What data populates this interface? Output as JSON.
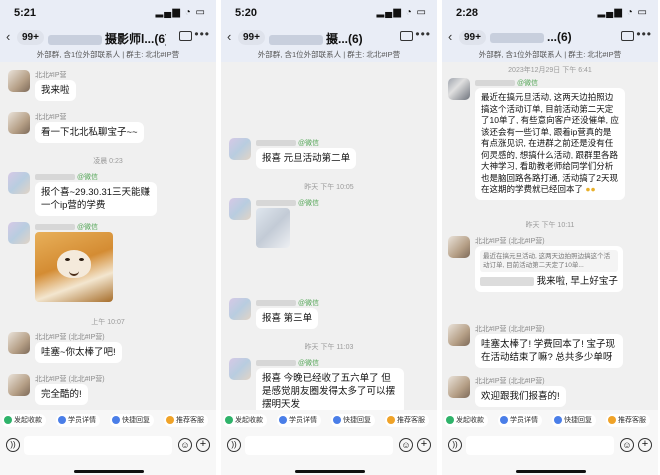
{
  "screens": [
    {
      "time": "5:21",
      "badge": "99+",
      "title": "摄影师l...(6)",
      "subinfo": "外部群, 含1位外部联系人 | 群主: 北北#IP营",
      "quick": [
        "发起收款",
        "学员详情",
        "快捷回复",
        "推荐客服"
      ],
      "messages": [
        {
          "name": "北北#IP营",
          "text": "我来啦"
        },
        {
          "name": "北北#IP营",
          "text": "看一下北北私聊宝子~~"
        },
        {
          "stamp": "凌晨 0:23"
        },
        {
          "name": "@微信",
          "text": "报个喜~29.30.31三天能赚一个ip营的学费"
        },
        {
          "name": "@微信",
          "image": "dog-emoji"
        },
        {
          "stamp": "上午 10:07"
        },
        {
          "name": "北北#IP营 (北北#IP营)",
          "text": "哇塞~你太棒了吧!"
        },
        {
          "name": "北北#IP营 (北北#IP营)",
          "text": "完全酷的!"
        }
      ]
    },
    {
      "time": "5:20",
      "badge": "99+",
      "title": "摄...(6)",
      "subinfo": "外部群, 含1位外部联系人 | 群主: 北北#IP营",
      "quick": [
        "发起收款",
        "学员详情",
        "快捷回复",
        "推荐客服"
      ],
      "messages": [
        {
          "name": "@微信",
          "text": "报喜 元旦活动第二单"
        },
        {
          "stamp": "昨天 下午 10:05"
        },
        {
          "name": "@微信",
          "image": "photo"
        },
        {
          "name": "@微信",
          "text": "报喜 第三单"
        },
        {
          "stamp": "昨天 下午 11:03"
        },
        {
          "name": "@微信",
          "text": "报喜 今晚已经收了五六单了 但是感觉朋友圈发得太多了可以摆摆明天发"
        }
      ]
    },
    {
      "time": "2:28",
      "badge": "99+",
      "title": "...(6)",
      "subinfo": "外部群, 含1位外部联系人 | 群主: 北北#IP营",
      "quick": [
        "发起收款",
        "学员详情",
        "快捷回复",
        "推荐客服"
      ],
      "messages": [
        {
          "stamp": "2023年12月29日 下午 6:41"
        },
        {
          "name": "@微信",
          "text": "最近在搞元旦活动, 这两天边拍照边搞这个活动订单, 目前活动第二天定了10单了, 有些意向客户还没催单, 应该还会有一些订单, 跟着ip营真的是有点涨见识, 在进群之前还是没有任何灵感的, 想搞什么活动, 跟群里各路大神学习, 看助教老师给同学们分析也是脑回路各路打通, 活动搞了2天现在这期的学费就已经回本了"
        },
        {
          "stamp": "昨天 下午 10:11"
        },
        {
          "name": "北北#IP营 (北北#IP营)",
          "quote": "最近在搞元旦活动, 这两天边拍照边搞这个活动订单, 目前活动第二天定了10单...",
          "text": "我来啦, 早上好宝子"
        },
        {
          "name": "北北#IP营 (北北#IP营)",
          "text": "哇塞太棒了! 学费回本了! 宝子现在活动结束了嘛? 总共多少单呀"
        },
        {
          "name": "北北#IP营 (北北#IP营)",
          "text": "欢迎跟我们报喜的!"
        }
      ]
    }
  ]
}
